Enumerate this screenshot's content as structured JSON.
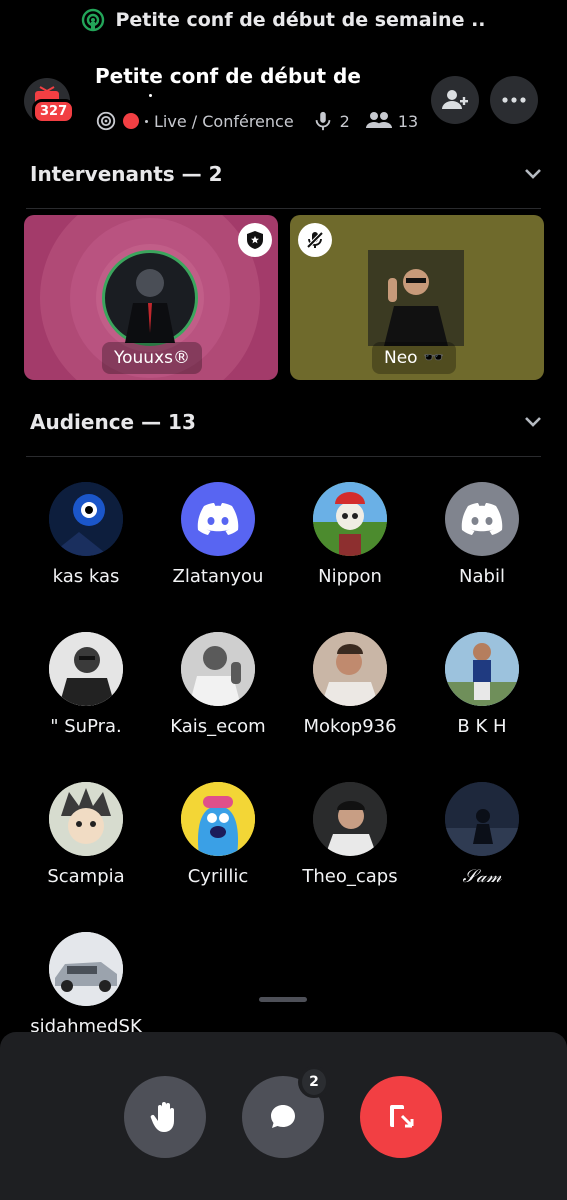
{
  "top_banner": {
    "title": "Petite conf de début de semaine ..",
    "icon": "stage-icon"
  },
  "header": {
    "title": "Petite conf de début de",
    "server_badge": "327",
    "stage_status": "Live / Conférence",
    "speaker_count": "2",
    "listener_count": "13",
    "live_indicator_color": "#f23f43"
  },
  "sections": {
    "speakers_label": "Intervenants — 2",
    "audience_label": "Audience — 13"
  },
  "speakers": [
    {
      "name": "Youuxs®",
      "color": "#a33b6a",
      "badge_icon": "moderator-shield-icon",
      "speaking": true
    },
    {
      "name": "Neo 🕶️",
      "color": "#6f6a2c",
      "badge_icon": "muted-mic-icon",
      "speaking": false
    }
  ],
  "audience": [
    {
      "name": "kas kas",
      "avatar": "eye-art"
    },
    {
      "name": "Zlatanyou",
      "avatar": "discord-default-blue"
    },
    {
      "name": "Nippon",
      "avatar": "skull-cap"
    },
    {
      "name": "Nabil",
      "avatar": "discord-default-grey"
    },
    {
      "name": "\" SuPra.",
      "avatar": "bw-portrait"
    },
    {
      "name": "Kais_ecom",
      "avatar": "bw-portrait"
    },
    {
      "name": "Mokop936",
      "avatar": "photo-portrait"
    },
    {
      "name": "B K H",
      "avatar": "photo-portrait"
    },
    {
      "name": "Scampia",
      "avatar": "anime"
    },
    {
      "name": "Cyrillic",
      "avatar": "cartoon"
    },
    {
      "name": "Theo_caps",
      "avatar": "car-selfie"
    },
    {
      "name": "𝒮𝒶𝓂",
      "avatar": "dark-photo"
    },
    {
      "name": "sidahmedSK",
      "avatar": "car"
    }
  ],
  "controls": {
    "chat_badge": "2",
    "leave_color": "#f23f43"
  }
}
